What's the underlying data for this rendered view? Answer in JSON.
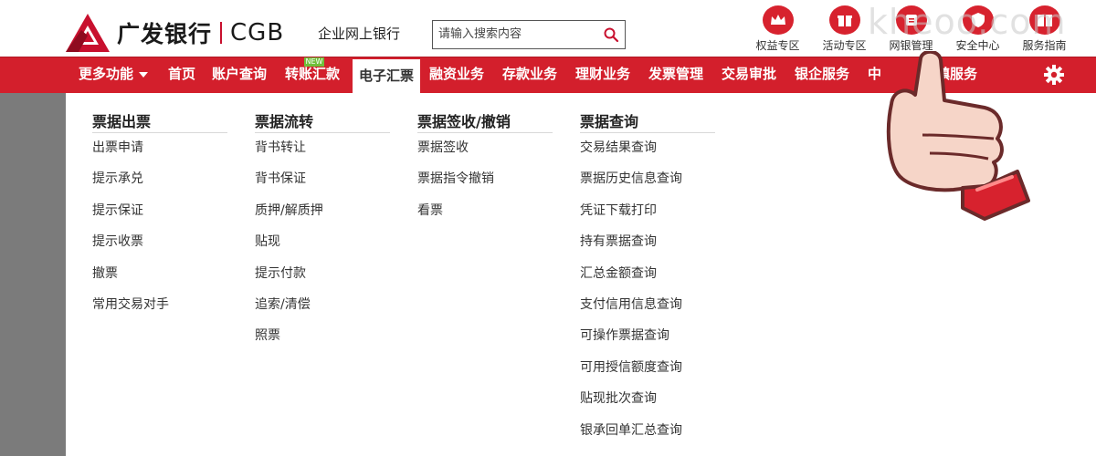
{
  "header": {
    "logo_cn": "广发银行",
    "logo_en": "CGB",
    "subtitle": "企业网上银行",
    "search_placeholder": "请输入搜索内容"
  },
  "shortcuts": [
    {
      "label": "权益专区",
      "icon": "crown-icon"
    },
    {
      "label": "活动专区",
      "icon": "gift-icon"
    },
    {
      "label": "网银管理",
      "icon": "manage-icon"
    },
    {
      "label": "安全中心",
      "icon": "shield-icon"
    },
    {
      "label": "服务指南",
      "icon": "book-icon"
    }
  ],
  "watermark": "kheoo.com",
  "nav": {
    "more": "更多功能",
    "items": [
      "首页",
      "账户查询",
      "转账汇款",
      "电子汇票",
      "融资业务",
      "存款业务",
      "理财业务",
      "发票管理",
      "交易审批",
      "银企服务",
      "中",
      "村镇服务"
    ],
    "active_index": 3,
    "new_badge": "NEW"
  },
  "menu": {
    "columns": [
      {
        "title": "票据出票",
        "items": [
          "出票申请",
          "提示承兑",
          "提示保证",
          "提示收票",
          "撤票",
          "常用交易对手"
        ]
      },
      {
        "title": "票据流转",
        "items": [
          "背书转让",
          "背书保证",
          "质押/解质押",
          "贴现",
          "提示付款",
          "追索/清偿",
          "照票"
        ]
      },
      {
        "title": "票据签收/撤销",
        "items": [
          "票据签收",
          "票据指令撤销",
          "看票"
        ]
      },
      {
        "title": "票据查询",
        "items": [
          "交易结果查询",
          "票据历史信息查询",
          "凭证下载打印",
          "持有票据查询",
          "汇总金额查询",
          "支付信用信息查询",
          "可操作票据查询",
          "可用授信额度查询",
          "贴现批次查询",
          "银承回单汇总查询"
        ]
      }
    ]
  },
  "colors": {
    "brand_red": "#d31f2c",
    "overlay_gray": "#7b7b7b"
  }
}
